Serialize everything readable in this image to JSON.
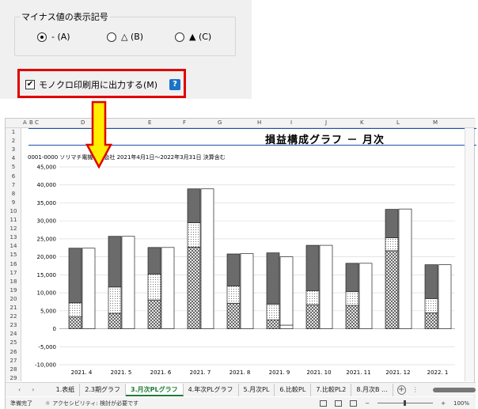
{
  "dialog": {
    "group_title": "マイナス値の表示記号",
    "radio_options": [
      {
        "label": "- (A)",
        "selected": true
      },
      {
        "label": "△ (B)",
        "selected": false
      },
      {
        "label": "▲ (C)",
        "selected": false
      }
    ],
    "mono_checkbox_label": "モノクロ印刷用に出力する(M)",
    "mono_checked": true,
    "help_icon": "?",
    "highlight_color": "#e00000"
  },
  "spreadsheet": {
    "columns": [
      "A",
      "B",
      "C",
      "D",
      "E",
      "F",
      "G",
      "H",
      "I",
      "J",
      "K",
      "L",
      "M"
    ],
    "rows": [
      "1",
      "2",
      "3",
      "4",
      "5",
      "6",
      "7",
      "8",
      "9",
      "10",
      "11",
      "12",
      "13",
      "14",
      "15",
      "16",
      "17",
      "18",
      "19",
      "20",
      "21",
      "22",
      "23",
      "24",
      "25",
      "26",
      "27",
      "28",
      "29"
    ],
    "title": "損益構成グラフ － 月次",
    "subtitle": "0001-0000 ソリマチ電機株式会社 2021年4月1日～2022年3月31日 決算含む",
    "tabs": [
      "1.表紙",
      "2.3期グラフ",
      "3.月次PLグラフ",
      "4.年次PLグラフ",
      "5.月次PL",
      "6.比較PL",
      "7.比較PL2",
      "8.月次B ..."
    ],
    "active_tab_index": 2,
    "status_ready": "準備完了",
    "status_accessibility": "アクセシビリティ: 検討が必要です",
    "zoom": "100%",
    "accent_color": "#1e7b36"
  },
  "chart_data": {
    "type": "bar",
    "categories": [
      "2021. 4",
      "2021. 5",
      "2021. 6",
      "2021. 7",
      "2021. 8",
      "2021. 9",
      "2021. 10",
      "2021. 11",
      "2021. 12",
      "2022. 1"
    ],
    "series": [
      {
        "values": [
          3300,
          4300,
          8000,
          22700,
          7100,
          2500,
          6700,
          6500,
          21700,
          4400
        ]
      },
      {
        "values": [
          3900,
          7300,
          7200,
          6800,
          4800,
          4300,
          3900,
          3800,
          3600,
          4000
        ]
      },
      {
        "values": [
          15200,
          14100,
          7400,
          9400,
          8900,
          14300,
          12600,
          7900,
          7900,
          9400
        ]
      },
      {
        "values": [
          22400,
          25700,
          22600,
          38900,
          20900,
          1000,
          23200,
          18200,
          33300,
          17800
        ]
      },
      {
        "values": [
          0,
          0,
          0,
          0,
          0,
          20000,
          0,
          0,
          0,
          0
        ]
      }
    ],
    "yticks": [
      "45,000",
      "40,000",
      "35,000",
      "30,000",
      "25,000",
      "20,000",
      "15,000",
      "10,000",
      "5,000",
      "0",
      "-5,000",
      "-10,000"
    ],
    "ylim": [
      -10000,
      45000
    ],
    "grid": true
  }
}
